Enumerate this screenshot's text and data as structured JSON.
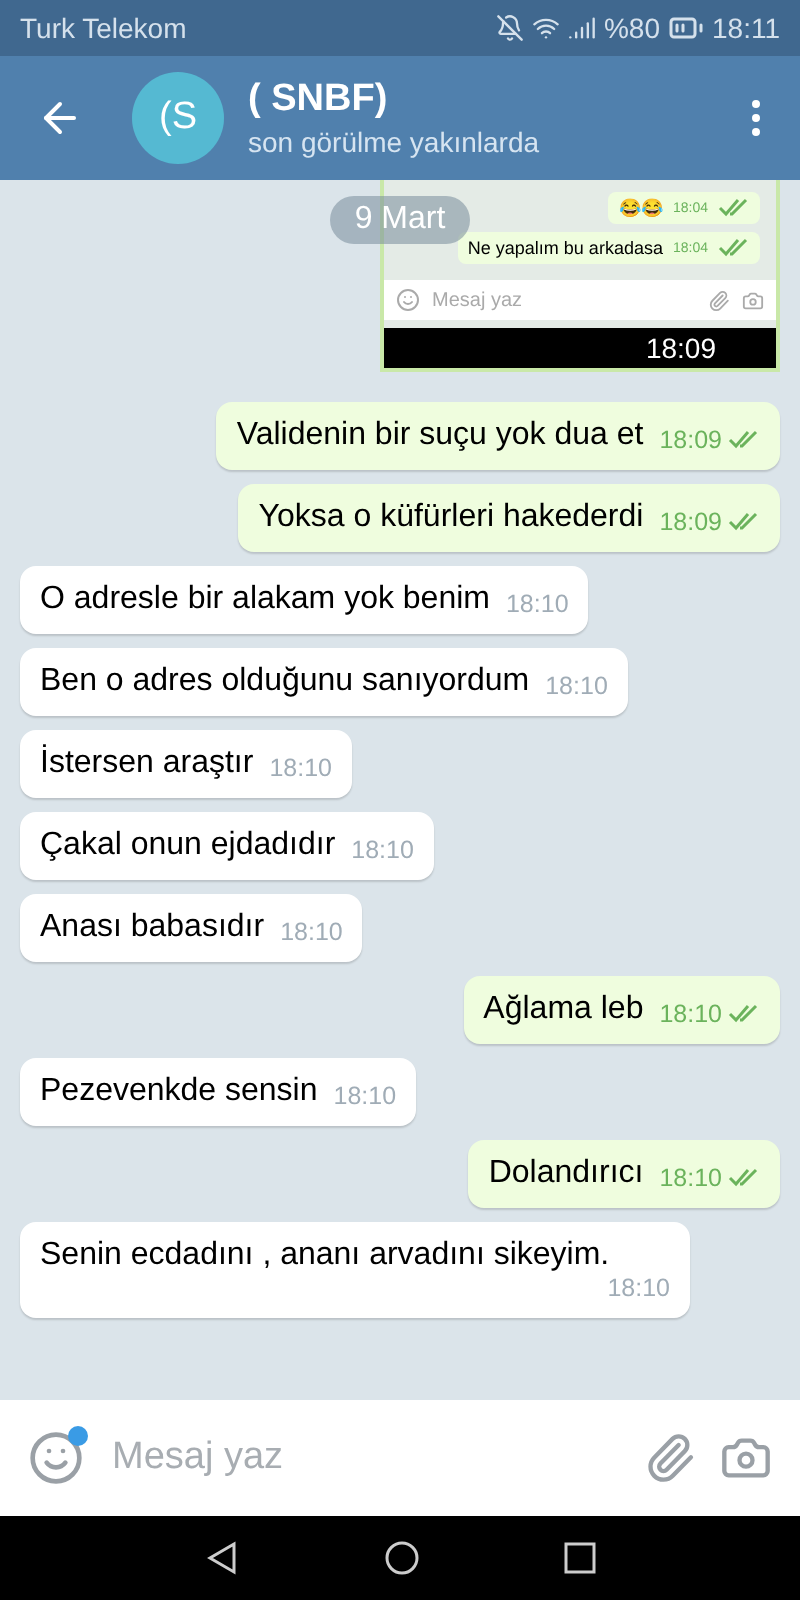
{
  "status_bar": {
    "carrier": "Turk Telekom",
    "battery": "%80",
    "time": "18:11"
  },
  "header": {
    "avatar": "(S",
    "title": "( SNBF)",
    "subtitle": "son görülme yakınlarda"
  },
  "date_chip": "9 Mart",
  "inset_screenshot": {
    "messages": [
      {
        "text": "😂😂",
        "time": "18:04",
        "read": true
      },
      {
        "text": "Ne yapalım bu arkadasa",
        "time": "18:04",
        "read": true
      }
    ],
    "placeholder": "Mesaj yaz",
    "time": "18:09"
  },
  "messages": [
    {
      "text": "Validenin bir suçu yok dua et",
      "time": "18:09",
      "outgoing": true,
      "read": true
    },
    {
      "text": "Yoksa o küfürleri hakederdi",
      "time": "18:09",
      "outgoing": true,
      "read": true
    },
    {
      "text": "O adresle bir alakam yok benim",
      "time": "18:10",
      "outgoing": false
    },
    {
      "text": "Ben o adres olduğunu sanıyordum",
      "time": "18:10",
      "outgoing": false
    },
    {
      "text": "İstersen araştır",
      "time": "18:10",
      "outgoing": false
    },
    {
      "text": "Çakal onun ejdadıdır",
      "time": "18:10",
      "outgoing": false
    },
    {
      "text": "Anası babasıdır",
      "time": "18:10",
      "outgoing": false
    },
    {
      "text": "Ağlama leb",
      "time": "18:10",
      "outgoing": true,
      "read": true
    },
    {
      "text": "Pezevenkde sensin",
      "time": "18:10",
      "outgoing": false
    },
    {
      "text": "Dolandırıcı",
      "time": "18:10",
      "outgoing": true,
      "read": true
    },
    {
      "text": "Senin ecdadını , ananı arvadını sikeyim.",
      "time": "18:10",
      "outgoing": false
    }
  ],
  "composer": {
    "placeholder": "Mesaj yaz"
  }
}
